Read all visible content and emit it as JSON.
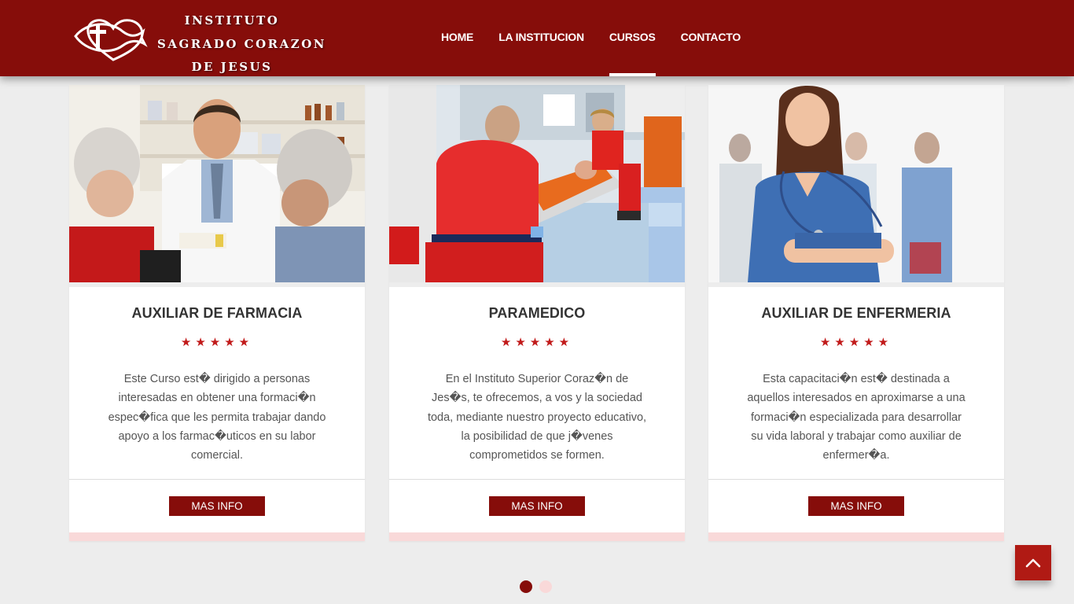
{
  "theme": {
    "primary": "#860d0a",
    "accent_star": "#c11a1a",
    "card_bottom": "#f9d9d9",
    "page_bg": "#ededed"
  },
  "logo": {
    "lines": [
      "INSTITUTO",
      "SAGRADO CORAZON",
      "DE JESUS"
    ],
    "icon": "cross-fish-heart-icon"
  },
  "nav": {
    "items": [
      {
        "label": "HOME",
        "active": false
      },
      {
        "label": "LA INSTITUCION",
        "active": false
      },
      {
        "label": "CURSOS",
        "active": true
      },
      {
        "label": "CONTACTO",
        "active": false
      }
    ]
  },
  "courses": [
    {
      "title": "AUXILIAR DE FARMACIA",
      "rating": 5,
      "description": "Este Curso est� dirigido a personas interesadas en obtener una formaci�n espec�fica que les permita trabajar dando apoyo a los farmac�uticos en su labor comercial.",
      "button": "MAS INFO"
    },
    {
      "title": "PARAMEDICO",
      "rating": 5,
      "description": "En el Instituto Superior Coraz�n de Jes�s, te ofrecemos, a vos y la sociedad toda, mediante nuestro proyecto educativo, la posibilidad de que j�venes comprometidos se formen.",
      "button": "MAS INFO"
    },
    {
      "title": "AUXILIAR DE ENFERMERIA",
      "rating": 5,
      "description": "Esta capacitaci�n est� destinada a aquellos interesados en aproximarse a una formaci�n especializada para desarrollar su vida laboral y trabajar como auxiliar de enfermer�a.",
      "button": "MAS INFO"
    }
  ],
  "pager": {
    "dots": [
      {
        "active": true,
        "color": "#860d0a"
      },
      {
        "active": false,
        "color": "#f9d9d9"
      }
    ]
  },
  "back_to_top": {
    "icon": "chevron-up-icon"
  }
}
